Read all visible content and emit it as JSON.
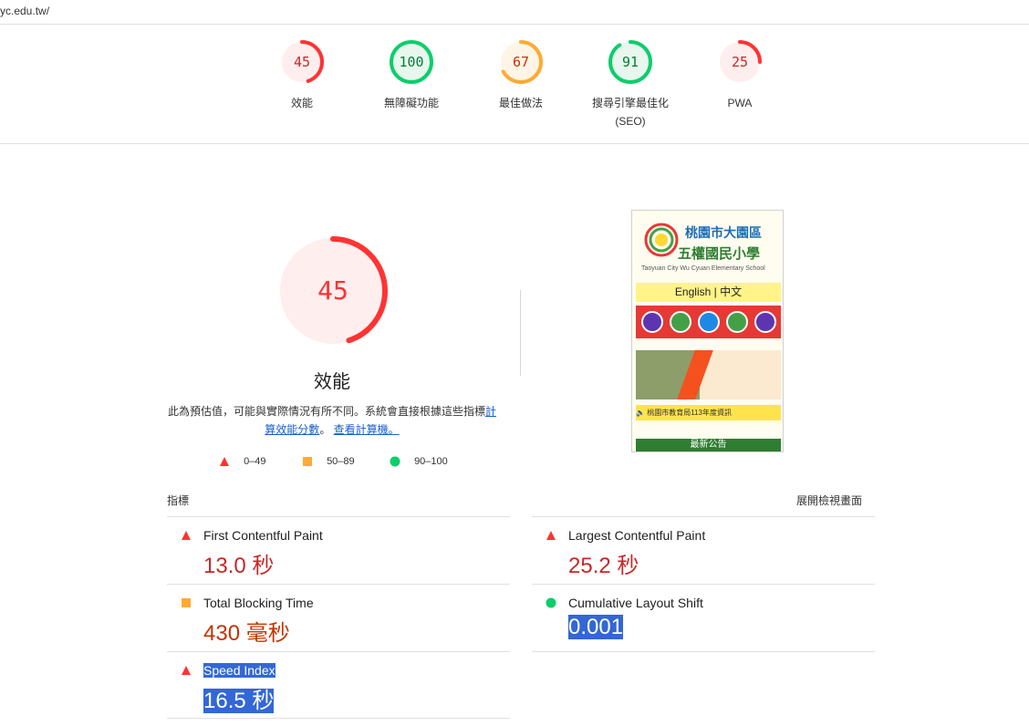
{
  "url": "yc.edu.tw/",
  "colors": {
    "fail": "#ff3333",
    "average": "#ffaa33",
    "pass": "#0cce6b"
  },
  "gauges": [
    {
      "score": "45",
      "score_value": 45,
      "label": "效能",
      "status": "fail"
    },
    {
      "score": "100",
      "score_value": 100,
      "label": "無障礙功能",
      "status": "pass"
    },
    {
      "score": "67",
      "score_value": 67,
      "label": "最佳做法",
      "status": "average"
    },
    {
      "score": "91",
      "score_value": 91,
      "label": "搜尋引擎最佳化",
      "label2": "(SEO)",
      "status": "pass"
    },
    {
      "score": "25",
      "score_value": 25,
      "label": "PWA",
      "status": "fail"
    }
  ],
  "performance": {
    "score": "45",
    "score_value": 45,
    "title": "效能",
    "desc_text": "此為預估值，可能與實際情況有所不同。系統會直接根據這些指標",
    "desc_link1": "計算效能分數",
    "desc_sep": "。",
    "desc_link2": "查看計算機。"
  },
  "legend": [
    {
      "icon": "triangle-icon",
      "range": "0–49"
    },
    {
      "icon": "square-icon",
      "range": "50–89"
    },
    {
      "icon": "circle-icon",
      "range": "90–100"
    }
  ],
  "screenshot_preview": {
    "name_line1": "桃園市大園區",
    "name_line2": "五權國民小學",
    "name_en": "Taoyuan City Wu Cyuan Elementary School",
    "lang_bar": "English | 中文",
    "ticker": "桃園市教育局113年度資訊",
    "news_label": "最新公告"
  },
  "metrics_header": {
    "left": "指標",
    "right": "展開檢視畫面"
  },
  "metrics": [
    {
      "name": "First Contentful Paint",
      "value": "13.0 秒",
      "status": "fail"
    },
    {
      "name": "Largest Contentful Paint",
      "value": "25.2 秒",
      "status": "fail"
    },
    {
      "name": "Total Blocking Time",
      "value": "430 毫秒",
      "status": "average"
    },
    {
      "name": "Cumulative Layout Shift",
      "value": "0.001",
      "status": "pass"
    },
    {
      "name": "Speed Index",
      "value": "16.5 秒",
      "status": "fail"
    }
  ]
}
